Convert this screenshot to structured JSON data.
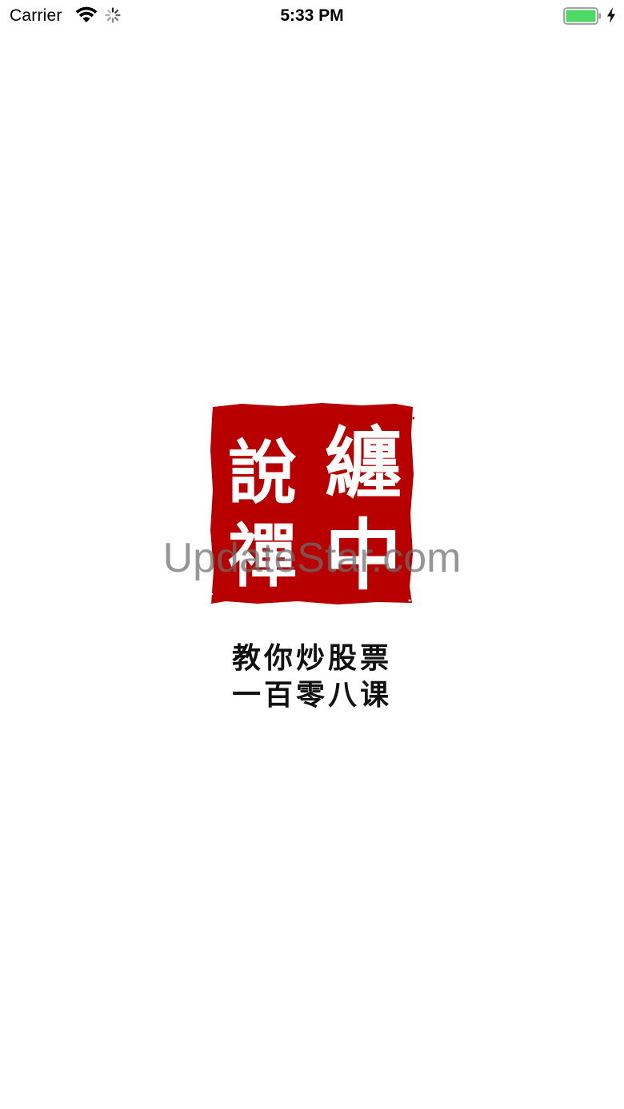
{
  "status_bar": {
    "carrier": "Carrier",
    "time": "5:33 PM",
    "icons": [
      "wifi-icon",
      "activity-spinner-icon",
      "battery-icon",
      "charging-bolt-icon"
    ],
    "battery_color": "#4cd964"
  },
  "splash": {
    "seal": {
      "characters_right_column": [
        "纏",
        "中"
      ],
      "characters_left_column": [
        "說",
        "禪"
      ],
      "color": "#b80000"
    },
    "tagline": {
      "line1": "教你炒股票",
      "line2": "一百零八课"
    }
  },
  "watermark": {
    "text": "UpdateStar.com"
  }
}
